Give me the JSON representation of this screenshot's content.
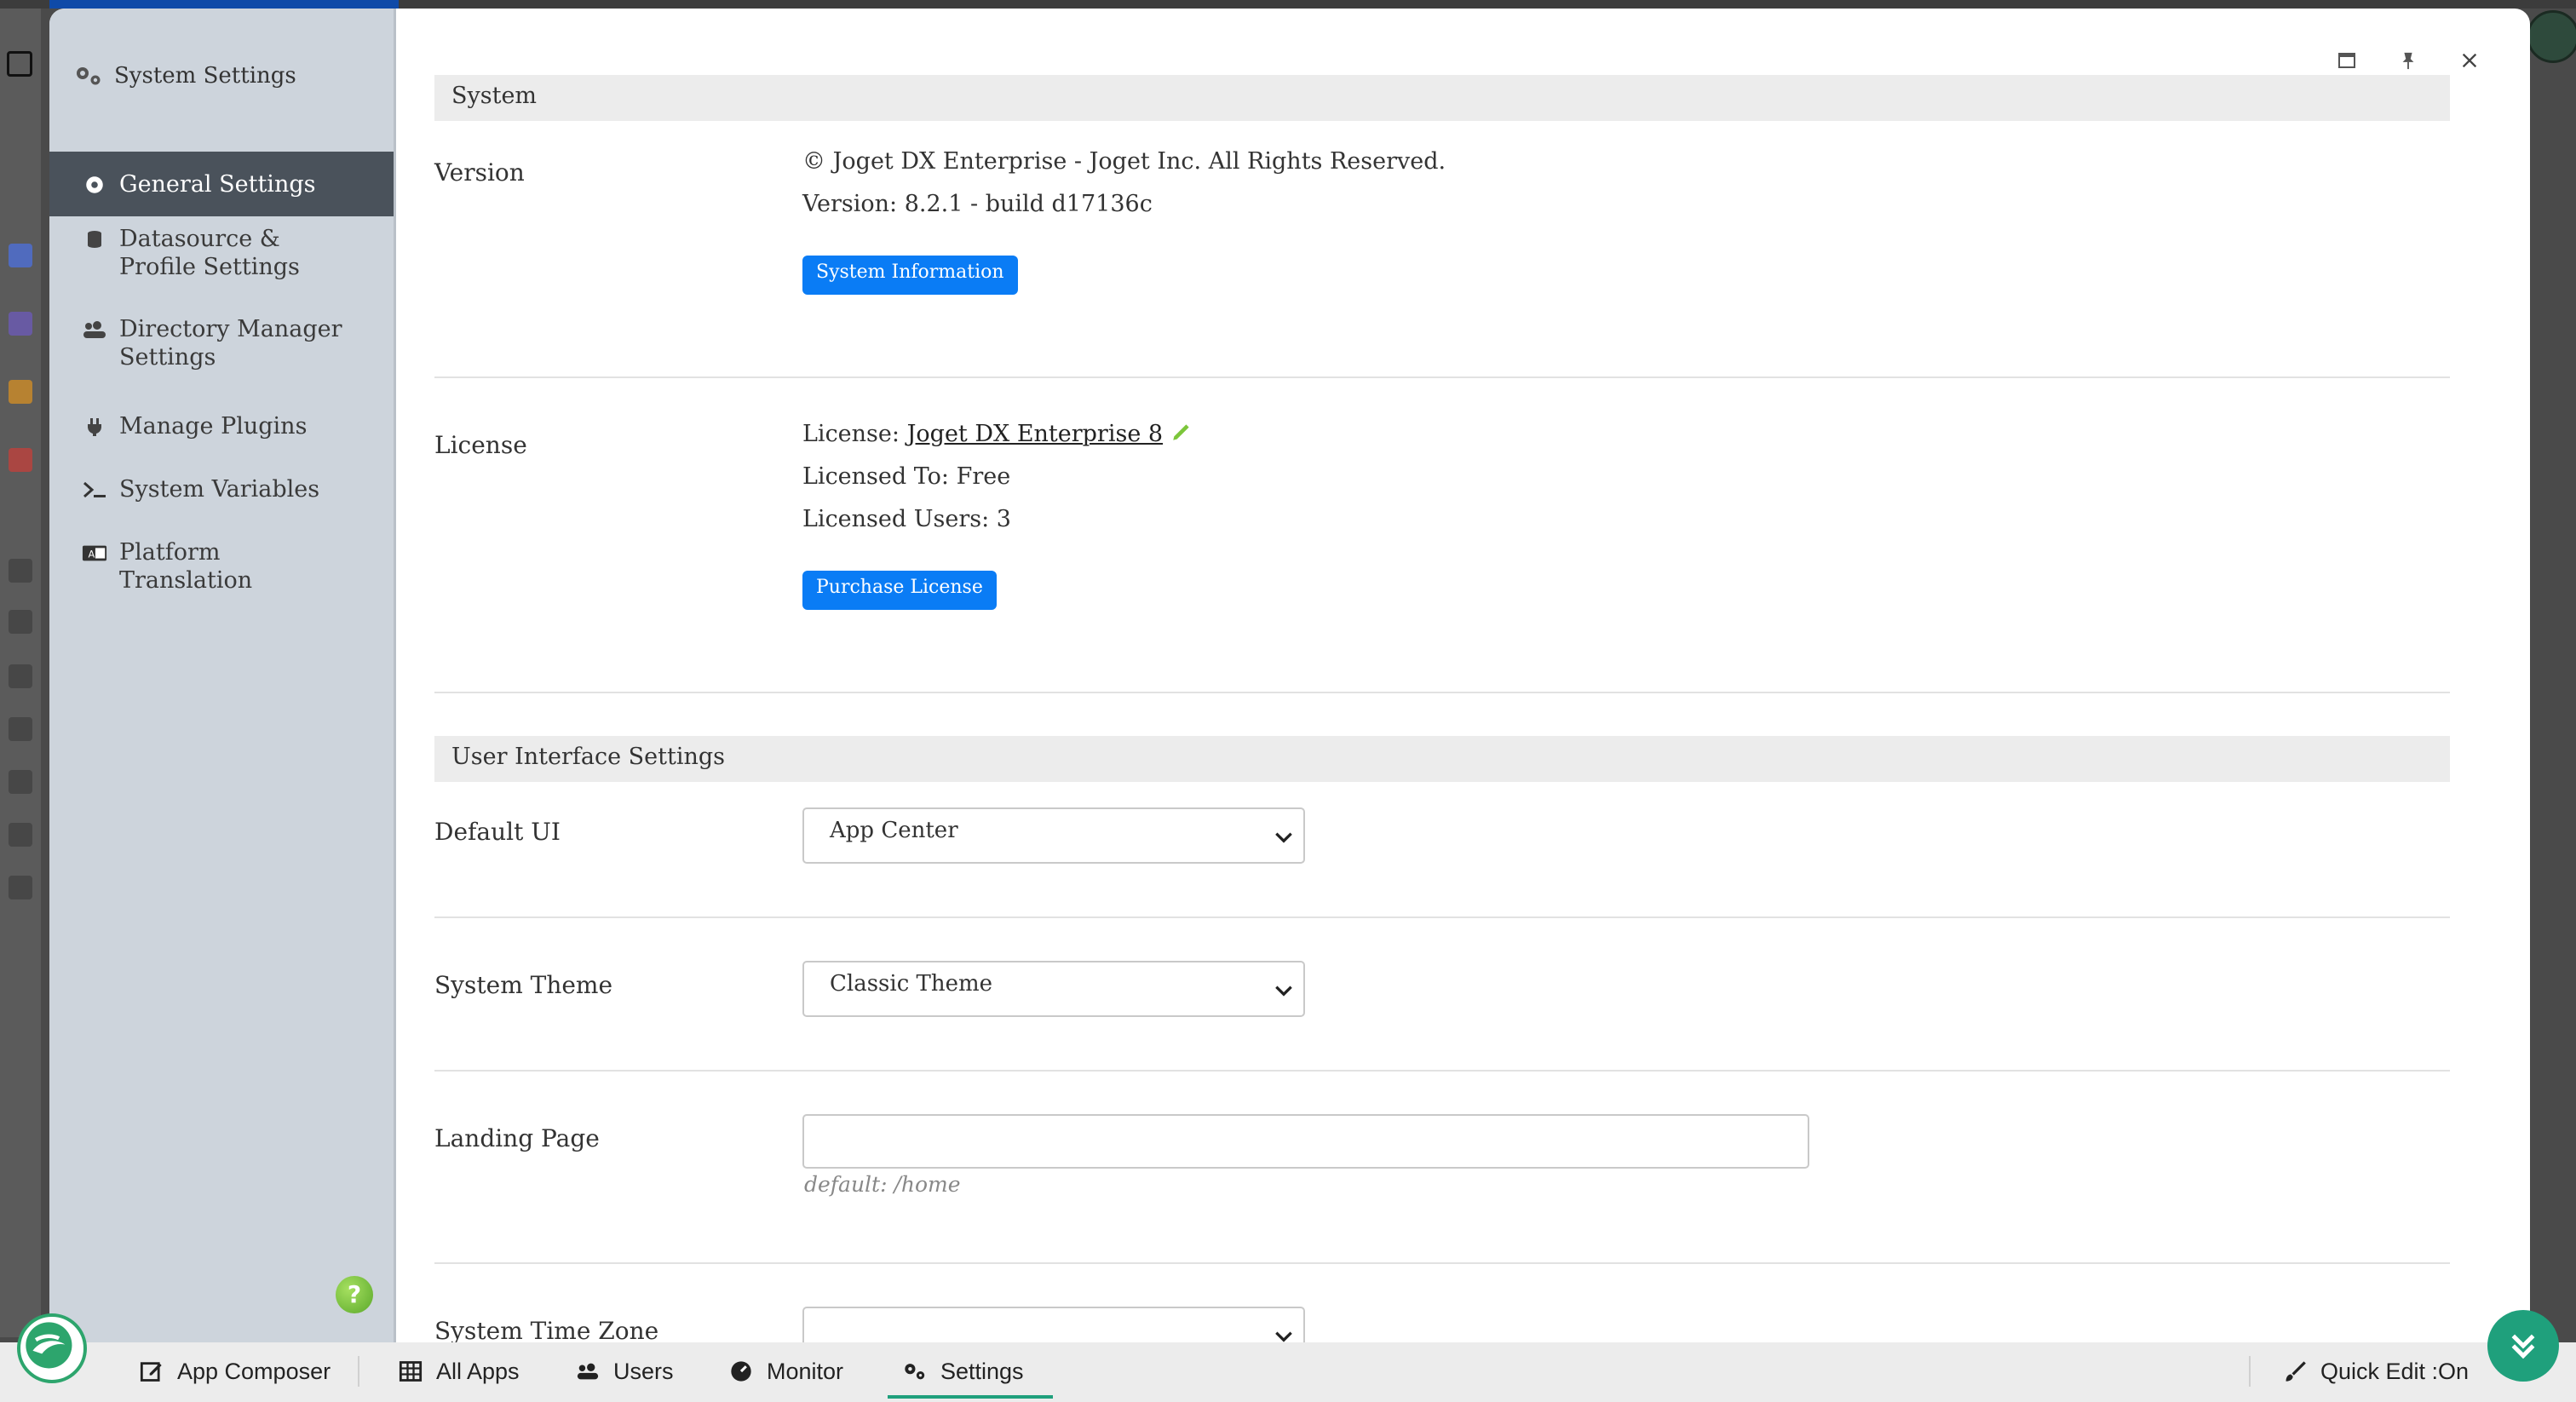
{
  "sidebar": {
    "title": "System Settings",
    "items": [
      {
        "label": "General Settings",
        "icon": "gear-icon"
      },
      {
        "label": "Datasource & Profile Settings",
        "icon": "database-icon"
      },
      {
        "label": "Directory Manager Settings",
        "icon": "users-icon"
      },
      {
        "label": "Manage Plugins",
        "icon": "plug-icon"
      },
      {
        "label": "System Variables",
        "icon": "terminal-icon"
      },
      {
        "label": "Platform Translation",
        "icon": "translate-icon"
      }
    ],
    "help": "?"
  },
  "system": {
    "section_title": "System",
    "version_label": "Version",
    "copyright": "© Joget DX Enterprise - Joget Inc. All Rights Reserved.",
    "version_text": "Version: 8.2.1 - build d17136c",
    "system_info_button": "System Information",
    "license_label": "License",
    "license_prefix": "License:",
    "license_link": "Joget DX Enterprise 8",
    "licensed_to": "Licensed To: Free",
    "licensed_users": "Licensed Users: 3",
    "purchase_button": "Purchase License"
  },
  "ui_settings": {
    "section_title": "User Interface Settings",
    "default_ui_label": "Default UI",
    "default_ui_value": "App Center",
    "system_theme_label": "System Theme",
    "system_theme_value": "Classic Theme",
    "landing_page_label": "Landing Page",
    "landing_page_value": "",
    "landing_page_hint": "default: /home",
    "timezone_label": "System Time Zone",
    "timezone_value": ""
  },
  "bottom_bar": {
    "items": [
      {
        "label": "App Composer",
        "icon": "edit-icon"
      },
      {
        "label": "All Apps",
        "icon": "grid-icon"
      },
      {
        "label": "Users",
        "icon": "users-icon"
      },
      {
        "label": "Monitor",
        "icon": "gauge-icon"
      },
      {
        "label": "Settings",
        "icon": "gears-icon"
      }
    ],
    "active": "Settings",
    "quick_edit": "Quick Edit :On"
  },
  "colors": {
    "accent_blue": "#0a7cf5",
    "active_nav": "#4a525b",
    "brand_green": "#1fa07c"
  }
}
